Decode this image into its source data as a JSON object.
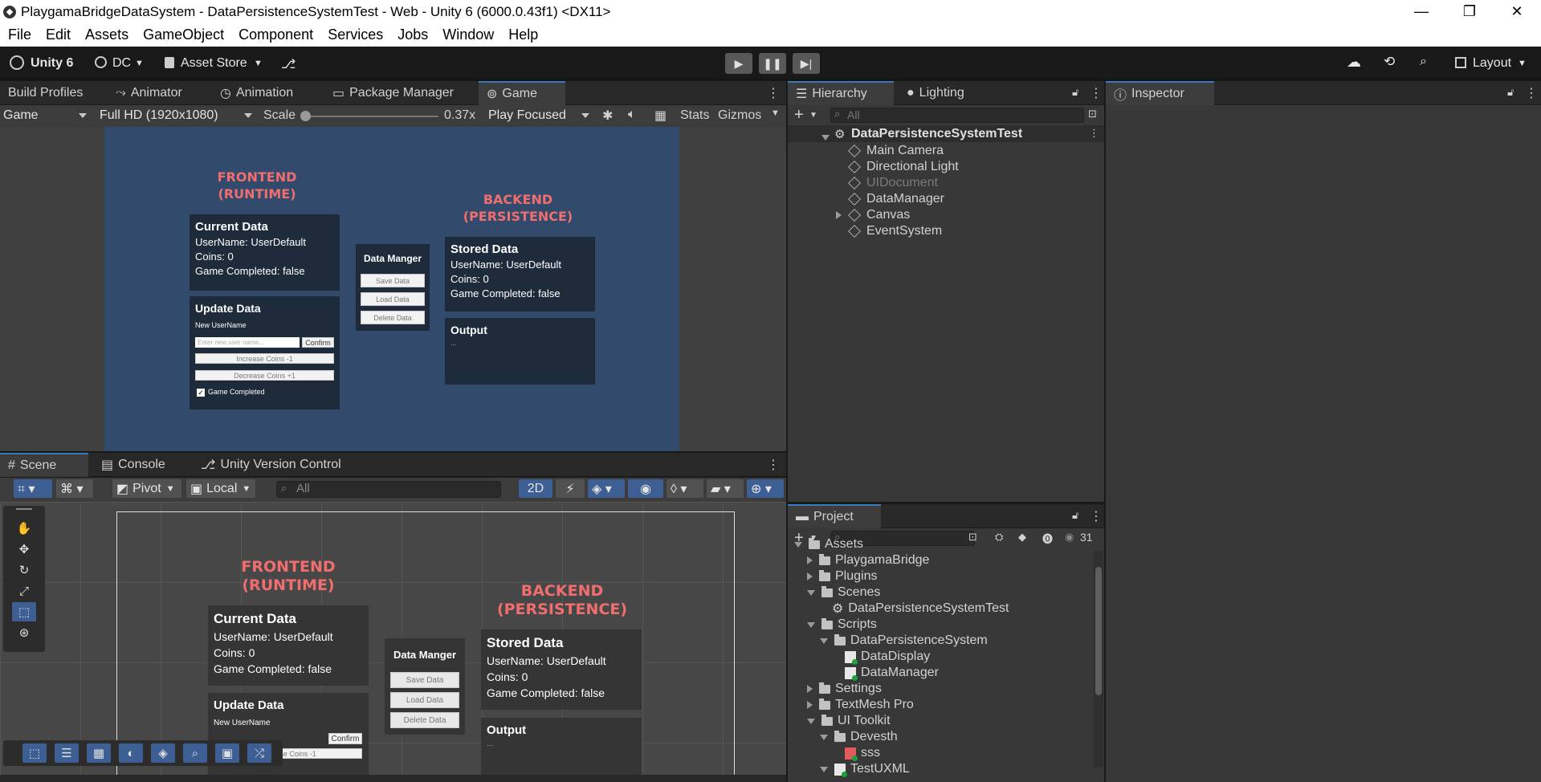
{
  "window": {
    "title": "PlaygamaBridgeDataSystem - DataPersistenceSystemTest - Web - Unity 6 (6000.0.43f1) <DX11>",
    "minimize": "—",
    "maximize": "❐",
    "close": "✕"
  },
  "menu": [
    "File",
    "Edit",
    "Assets",
    "GameObject",
    "Component",
    "Services",
    "Jobs",
    "Window",
    "Help"
  ],
  "toolbar": {
    "unity_label": "Unity 6",
    "account": "DC",
    "asset_store": "Asset Store",
    "layout": "Layout"
  },
  "top_tabs": [
    "Build Profiles",
    "Animator",
    "Animation",
    "Package Manager",
    "Game"
  ],
  "game_controls": {
    "display": "Game",
    "resolution": "Full HD (1920x1080)",
    "scale_label": "Scale",
    "scale_value": "0.37x",
    "play_mode": "Play Focused",
    "stats": "Stats",
    "gizmos": "Gizmos"
  },
  "ui_canvas": {
    "frontend_title_1": "FRONTEND",
    "frontend_title_2": "(RUNTIME)",
    "backend_title_1": "BACKEND",
    "backend_title_2": "(PERSISTENCE)",
    "current_data": {
      "heading": "Current Data",
      "username_label": "UserName:",
      "username_value": "UserDefault",
      "coins": "Coins: 0",
      "game_completed": "Game Completed: false"
    },
    "update_data": {
      "heading": "Update Data",
      "new_username_label": "New UserName",
      "input_placeholder": "Enter new user name...",
      "confirm": "Confirm",
      "increase": "Increase Coins -1",
      "decrease": "Decrease Coins +1",
      "game_completed_toggle": "Game Completed",
      "game_completed_checked": true
    },
    "data_manager": {
      "heading": "Data Manger",
      "save": "Save Data",
      "load": "Load Data",
      "delete": "Delete Data"
    },
    "stored_data": {
      "heading": "Stored Data",
      "username_label": "UserName:",
      "username_value": "UserDefault",
      "coins": "Coins: 0",
      "game_completed": "Game Completed: false"
    },
    "output": {
      "heading": "Output",
      "text": "..."
    }
  },
  "bottom_tabs": [
    "Scene",
    "Console",
    "Unity Version Control"
  ],
  "scene_controls": {
    "pivot": "Pivot",
    "local": "Local",
    "search_placeholder": "All",
    "mode_2d": "2D"
  },
  "hierarchy": {
    "tabs": [
      "Hierarchy",
      "Lighting"
    ],
    "search_placeholder": "All",
    "scene": "DataPersistenceSystemTest",
    "items": [
      {
        "label": "Main Camera",
        "disabled": false,
        "expandable": false
      },
      {
        "label": "Directional Light",
        "disabled": false,
        "expandable": false
      },
      {
        "label": "UIDocument",
        "disabled": true,
        "expandable": false
      },
      {
        "label": "DataManager",
        "disabled": false,
        "expandable": false
      },
      {
        "label": "Canvas",
        "disabled": false,
        "expandable": true
      },
      {
        "label": "EventSystem",
        "disabled": false,
        "expandable": false
      }
    ]
  },
  "inspector": {
    "tab": "Inspector"
  },
  "project": {
    "tab": "Project",
    "count": "31",
    "items": [
      {
        "label": "Assets",
        "type": "folder",
        "indent": 0,
        "arrow": "down"
      },
      {
        "label": "PlaygamaBridge",
        "type": "folder",
        "indent": 1,
        "arrow": "right"
      },
      {
        "label": "Plugins",
        "type": "folder",
        "indent": 1,
        "arrow": "right"
      },
      {
        "label": "Scenes",
        "type": "folder",
        "indent": 1,
        "arrow": "down"
      },
      {
        "label": "DataPersistenceSystemTest",
        "type": "scene",
        "indent": 2,
        "arrow": "none"
      },
      {
        "label": "Scripts",
        "type": "folder",
        "indent": 1,
        "arrow": "down"
      },
      {
        "label": "DataPersistenceSystem",
        "type": "folder",
        "indent": 2,
        "arrow": "down"
      },
      {
        "label": "DataDisplay",
        "type": "script",
        "indent": 3,
        "arrow": "none"
      },
      {
        "label": "DataManager",
        "type": "script",
        "indent": 3,
        "arrow": "none"
      },
      {
        "label": "Settings",
        "type": "folder",
        "indent": 1,
        "arrow": "right"
      },
      {
        "label": "TextMesh Pro",
        "type": "folder",
        "indent": 1,
        "arrow": "right"
      },
      {
        "label": "UI Toolkit",
        "type": "folder",
        "indent": 1,
        "arrow": "down"
      },
      {
        "label": "Devesth",
        "type": "folder",
        "indent": 2,
        "arrow": "down"
      },
      {
        "label": "sss",
        "type": "uss",
        "indent": 3,
        "arrow": "none"
      },
      {
        "label": "TestUXML",
        "type": "uxml",
        "indent": 2,
        "arrow": "down"
      }
    ]
  }
}
